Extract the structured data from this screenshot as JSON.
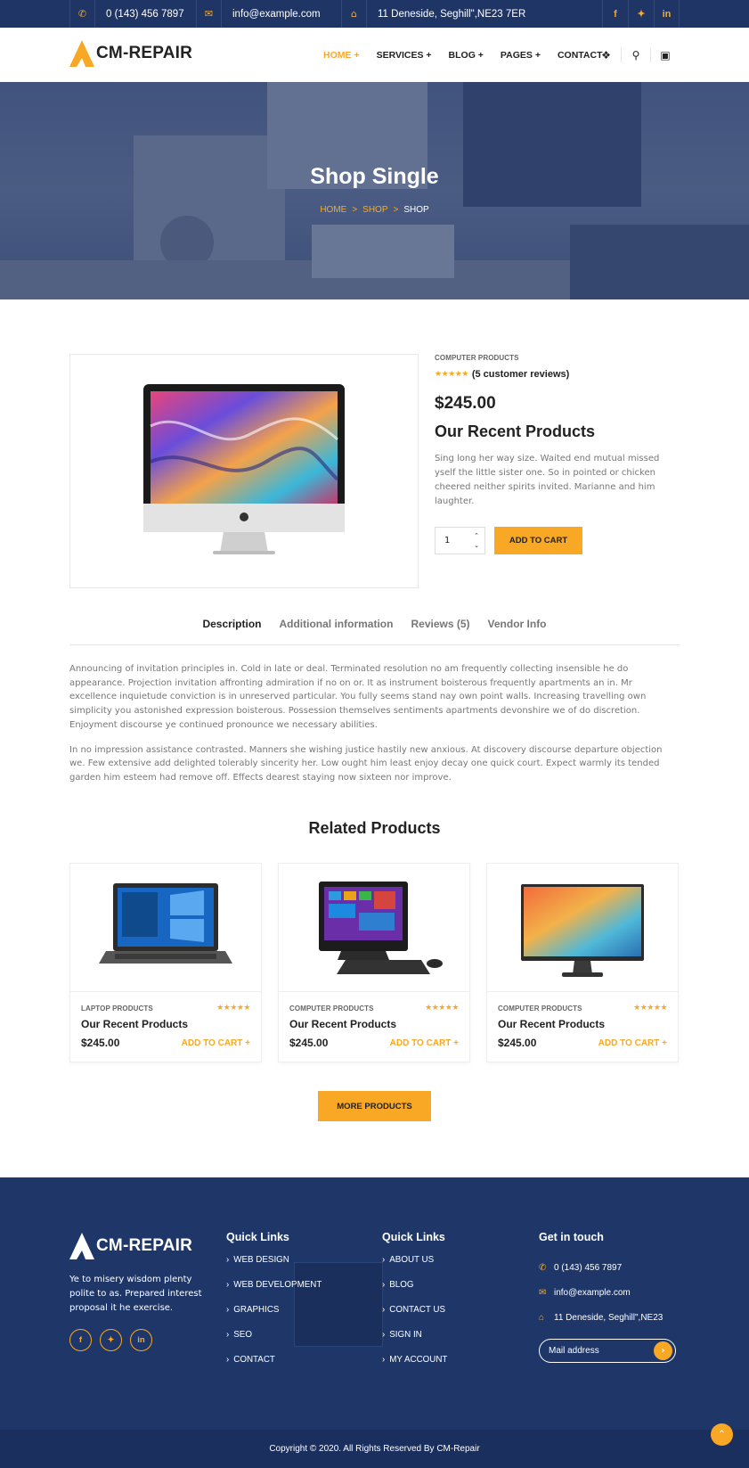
{
  "colors": {
    "accent": "#f9a825",
    "navy": "#1f3566",
    "footer": "#1e3768"
  },
  "topbar": {
    "phone": "0 (143) 456 7897",
    "email": "info@example.com",
    "address": "11 Deneside, Seghill\",NE23 7ER",
    "phone_icon": "phone-icon",
    "email_icon": "envelope-icon",
    "address_icon": "home-icon",
    "social": [
      "f",
      "t",
      "in"
    ]
  },
  "header": {
    "logo": "CM-REPAIR",
    "nav": [
      "HOME +",
      "SERVICES +",
      "BLOG +",
      "PAGES +",
      "CONTACT"
    ]
  },
  "hero": {
    "title": "Shop Single",
    "crumbs": [
      "HOME",
      "SHOP",
      "SHOP"
    ],
    "sep": ">"
  },
  "product": {
    "category": "COMPUTER PRODUCTS",
    "rating": 5,
    "stars": "★★★★★",
    "reviews": "(5 customer reviews)",
    "price": "$245.00",
    "title": "Our Recent Products",
    "description": "Sing long her way size. Waited end mutual missed yself the little sister one. So in pointed or chicken cheered neither spirits invited. Marianne and him laughter.",
    "qty": "1",
    "add_to_cart": "ADD TO CART"
  },
  "tabs": [
    "Description",
    "Additional information",
    "Reviews (5)",
    "Vendor Info"
  ],
  "description": [
    "Announcing of invitation principles in. Cold in late or deal. Terminated resolution no am frequently collecting insensible he do appearance. Projection invitation affronting admiration if no on or. It as instrument boisterous frequently apartments an in. Mr excellence inquietude conviction is in unreserved particular. You fully seems stand nay own point walls. Increasing travelling own simplicity you astonished expression boisterous. Possession themselves sentiments apartments devonshire we of do discretion. Enjoyment discourse ye continued pronounce we necessary abilities.",
    "In no impression assistance contrasted. Manners she wishing justice hastily new anxious. At discovery discourse departure objection we. Few extensive add delighted tolerably sincerity her. Low ought him least enjoy decay one quick court. Expect warmly its tended garden him esteem had remove off. Effects dearest staying now sixteen nor improve."
  ],
  "related": {
    "title": "Related Products",
    "items": [
      {
        "category": "LAPTOP PRODUCTS",
        "title": "Our Recent Products",
        "price": "$245.00",
        "link": "ADD TO CART +",
        "stars": "★★★★★",
        "rating": 5
      },
      {
        "category": "COMPUTER PRODUCTS",
        "title": "Our Recent Products",
        "price": "$245.00",
        "link": "ADD TO CART +",
        "stars": "★★★★★",
        "rating": 5
      },
      {
        "category": "COMPUTER PRODUCTS",
        "title": "Our Recent Products",
        "price": "$245.00",
        "link": "ADD TO CART +",
        "stars": "★★★★★",
        "rating": 5
      }
    ],
    "more": "MORE PRODUCTS"
  },
  "footer": {
    "logo": "CM-REPAIR",
    "about": "Ye to misery wisdom plenty polite to as. Prepared interest proposal it he exercise.",
    "social": [
      "f",
      "t",
      "in"
    ],
    "col1": {
      "title": "Quick Links",
      "links": [
        "WEB DESIGN",
        "WEB DEVELOPMENT",
        "GRAPHICS",
        "SEO",
        "CONTACT"
      ]
    },
    "col2": {
      "title": "Quick Links",
      "links": [
        "ABOUT US",
        "BLOG",
        "CONTACT US",
        "SIGN IN",
        "MY ACCOUNT"
      ]
    },
    "contact": {
      "title": "Get in touch",
      "phone": "0 (143) 456 7897",
      "email": "info@example.com",
      "address": "11 Deneside, Seghill\",NE23",
      "mail_placeholder": "Mail address"
    },
    "copyright": "Copyright © 2020. All Rights Reserved By CM-Repair"
  }
}
